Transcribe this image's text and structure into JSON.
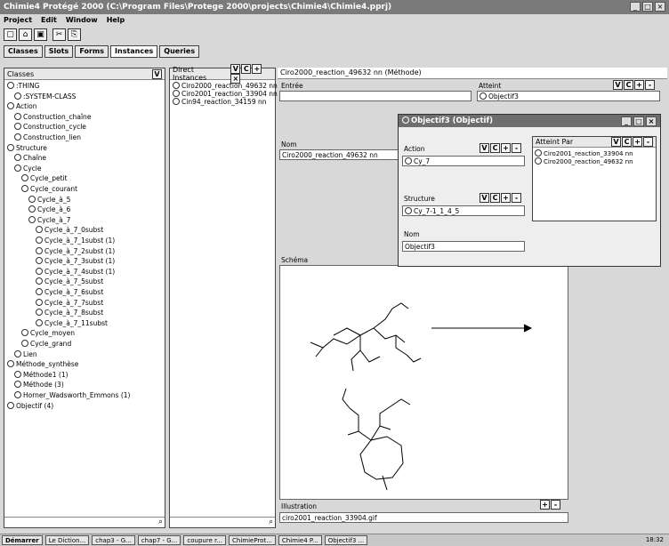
{
  "window": {
    "title": "Chimie4 Protégé 2000 (C:\\Program Files\\Protege 2000\\projects\\Chimie4\\Chimie4.pprj)",
    "controls": [
      "_",
      "□",
      "×"
    ]
  },
  "menu": [
    "Project",
    "Edit",
    "Window",
    "Help"
  ],
  "toolbar": [
    "new",
    "open",
    "save",
    "cut",
    "copy"
  ],
  "tabs": [
    {
      "label": "Classes",
      "active": false
    },
    {
      "label": "Slots",
      "active": false
    },
    {
      "label": "Forms",
      "active": false
    },
    {
      "label": "Instances",
      "active": true
    },
    {
      "label": "Queries",
      "active": false
    }
  ],
  "classes_panel": {
    "header": "Classes",
    "tree": [
      {
        "label": ":THING",
        "level": 0
      },
      {
        "label": ":SYSTEM-CLASS",
        "level": 1
      },
      {
        "label": "Action",
        "level": 0
      },
      {
        "label": "Construction_chaîne",
        "level": 1
      },
      {
        "label": "Construction_cycle",
        "level": 1
      },
      {
        "label": "Construction_lien",
        "level": 1
      },
      {
        "label": "Structure",
        "level": 0
      },
      {
        "label": "Chaîne",
        "level": 1
      },
      {
        "label": "Cycle",
        "level": 1
      },
      {
        "label": "Cycle_petit",
        "level": 2
      },
      {
        "label": "Cycle_courant",
        "level": 2
      },
      {
        "label": "Cycle_à_5",
        "level": 3
      },
      {
        "label": "Cycle_à_6",
        "level": 3
      },
      {
        "label": "Cycle_à_7",
        "level": 3
      },
      {
        "label": "Cycle_à_7_0subst",
        "level": 4
      },
      {
        "label": "Cycle_à_7_1subst  (1)",
        "level": 4
      },
      {
        "label": "Cycle_à_7_2subst  (1)",
        "level": 4
      },
      {
        "label": "Cycle_à_7_3subst  (1)",
        "level": 4
      },
      {
        "label": "Cycle_à_7_4subst  (1)",
        "level": 4
      },
      {
        "label": "Cycle_à_7_5subst",
        "level": 4
      },
      {
        "label": "Cycle_à_7_6subst",
        "level": 4
      },
      {
        "label": "Cycle_à_7_7subst",
        "level": 4
      },
      {
        "label": "Cycle_à_7_8subst",
        "level": 4
      },
      {
        "label": "Cycle_à_7_11subst",
        "level": 4
      },
      {
        "label": "Cycle_moyen",
        "level": 2
      },
      {
        "label": "Cycle_grand",
        "level": 2
      },
      {
        "label": "Lien",
        "level": 1
      },
      {
        "label": "Méthode_synthèse",
        "level": 0
      },
      {
        "label": "Méthode1  (1)",
        "level": 1
      },
      {
        "label": "Méthode  (3)",
        "level": 1
      },
      {
        "label": "Horner_Wadsworth_Emmons  (1)",
        "level": 1
      },
      {
        "label": "Objectif  (4)",
        "level": 0
      }
    ]
  },
  "instances_panel": {
    "header": "Direct Instances",
    "items": [
      "Ciro2000_reaction_49632 nn",
      "Ciro2001_reaction_33904 nn",
      "Cin94_reaction_34159 nn"
    ],
    "buttons": [
      "V",
      "C",
      "+",
      "×"
    ]
  },
  "form_panel": {
    "title": "Ciro2000_reaction_49632 nn (Méthode)",
    "champs": {
      "label": "Entrée",
      "value": ""
    },
    "atteint": {
      "label": "Atteint",
      "value": "Objectif3"
    },
    "nom": {
      "label": "Nom",
      "value": "Ciro2000_reaction_49632 nn"
    },
    "schema_label": "Schéma",
    "fichier": {
      "label": "Illustration",
      "value": "ciro2001_reaction_33904.gif"
    }
  },
  "dialog": {
    "title": "Objectif3 (Objectif)",
    "action": {
      "label": "Action",
      "value": "Cy_7"
    },
    "structure": {
      "label": "Structure",
      "value": "Cy_7-1_1_4_5"
    },
    "nom": {
      "label": "Nom",
      "value": "Objectif3"
    },
    "atteint_par": {
      "label": "Atteint Par",
      "items": [
        "Ciro2001_reaction_33904 nn",
        "Ciro2000_reaction_49632 nn"
      ]
    },
    "buttons": [
      "V",
      "C",
      "+",
      "-"
    ]
  },
  "taskbar": [
    {
      "label": "Démarrer",
      "start": true
    },
    {
      "label": "Le Diction..."
    },
    {
      "label": "chap3 - G..."
    },
    {
      "label": "chap7 - G..."
    },
    {
      "label": "coupure r..."
    },
    {
      "label": "ChimieProt..."
    },
    {
      "label": "Chimie4 P..."
    },
    {
      "label": "Objectif3 ..."
    }
  ],
  "clock": "18:32"
}
